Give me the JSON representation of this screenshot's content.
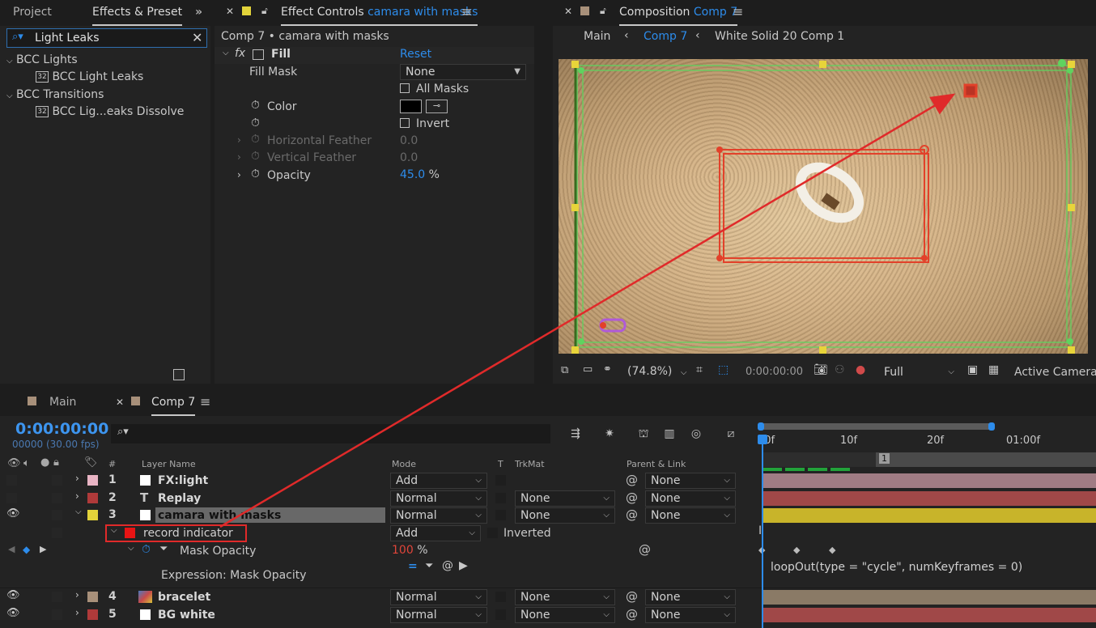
{
  "project_panel": {
    "tabs": [
      "Project",
      "Effects & Preset"
    ],
    "more_glyph": "»",
    "search_value": "Light Leaks",
    "tree": [
      {
        "label": "BCC Lights",
        "depth": 0
      },
      {
        "label": "BCC Light Leaks",
        "depth": 1,
        "badge": "32"
      },
      {
        "label": "BCC Transitions",
        "depth": 0
      },
      {
        "label": "BCC Lig...eaks Dissolve",
        "depth": 1,
        "badge": "32"
      }
    ]
  },
  "effect_controls": {
    "tab_prefix": "Effect Controls",
    "tab_target": "camara with masks",
    "header": "Comp 7 • camara with masks",
    "effect_name": "Fill",
    "fx_label": "fx",
    "reset": "Reset",
    "fill_mask_label": "Fill Mask",
    "fill_mask_value": "None",
    "all_masks": "All Masks",
    "color_label": "Color",
    "invert": "Invert",
    "horizontal_feather_label": "Horizontal Feather",
    "horizontal_feather_value": "0.0",
    "vertical_feather_label": "Vertical Feather",
    "vertical_feather_value": "0.0",
    "opacity_label": "Opacity",
    "opacity_value": "45.0",
    "opacity_unit": "%"
  },
  "composition": {
    "tab_prefix": "Composition",
    "tab_target": "Comp 7",
    "breadcrumb": [
      "Main",
      "Comp 7",
      "White Solid 20 Comp 1"
    ],
    "zoom": "(74.8%)",
    "timecode": "0:00:00:00",
    "resolution": "Full",
    "camera": "Active Camera",
    "colors": {
      "accent": "#2d8ceb",
      "mask_red": "#e2412a",
      "guide_green": "#5fd35f",
      "handle_yellow": "#e8d43a"
    }
  },
  "timeline": {
    "tabs": [
      "Main",
      "Comp 7"
    ],
    "timecode": "0:00:00:00",
    "frame_info": "00000 (30.00 fps)",
    "columns": {
      "hash": "#",
      "layer_name": "Layer Name",
      "mode": "Mode",
      "t": "T",
      "trkmat": "TrkMat",
      "parent": "Parent & Link"
    },
    "ruler": [
      "00f",
      "10f",
      "20f",
      "01:00f"
    ],
    "marker": "1",
    "layers": [
      {
        "num": "1",
        "name": "FX:light",
        "mode": "Add",
        "trkmat": "",
        "parent": "None",
        "color": "#e8b4c4",
        "type": "solid"
      },
      {
        "num": "2",
        "name": "Replay",
        "mode": "Normal",
        "trkmat": "None",
        "parent": "None",
        "color": "#b03a3a",
        "type": "text",
        "type_glyph": "T"
      },
      {
        "num": "3",
        "name": "camara with masks",
        "mode": "Normal",
        "trkmat": "None",
        "parent": "None",
        "color": "#e2d33a",
        "type": "solid"
      },
      {
        "num": "4",
        "name": "bracelet",
        "mode": "Normal",
        "trkmat": "None",
        "parent": "None",
        "color": "#a8907a",
        "type": "footage"
      },
      {
        "num": "5",
        "name": "BG white",
        "mode": "Normal",
        "trkmat": "None",
        "parent": "None",
        "color": "#b03a3a",
        "type": "solid"
      }
    ],
    "mask": {
      "name": "record indicator",
      "mode": "Add",
      "inverted_label": "Inverted"
    },
    "mask_opacity": {
      "label": "Mask Opacity",
      "value": "100",
      "unit": "%"
    },
    "expression_label": "Expression: Mask Opacity",
    "expression_text": "loopOut(type = \"cycle\", numKeyframes = 0)",
    "bar_colors": {
      "1": "#a07c84",
      "2": "#a04848",
      "3": "#c8b42a",
      "4": "#8a7a66",
      "5": "#a04848"
    }
  }
}
